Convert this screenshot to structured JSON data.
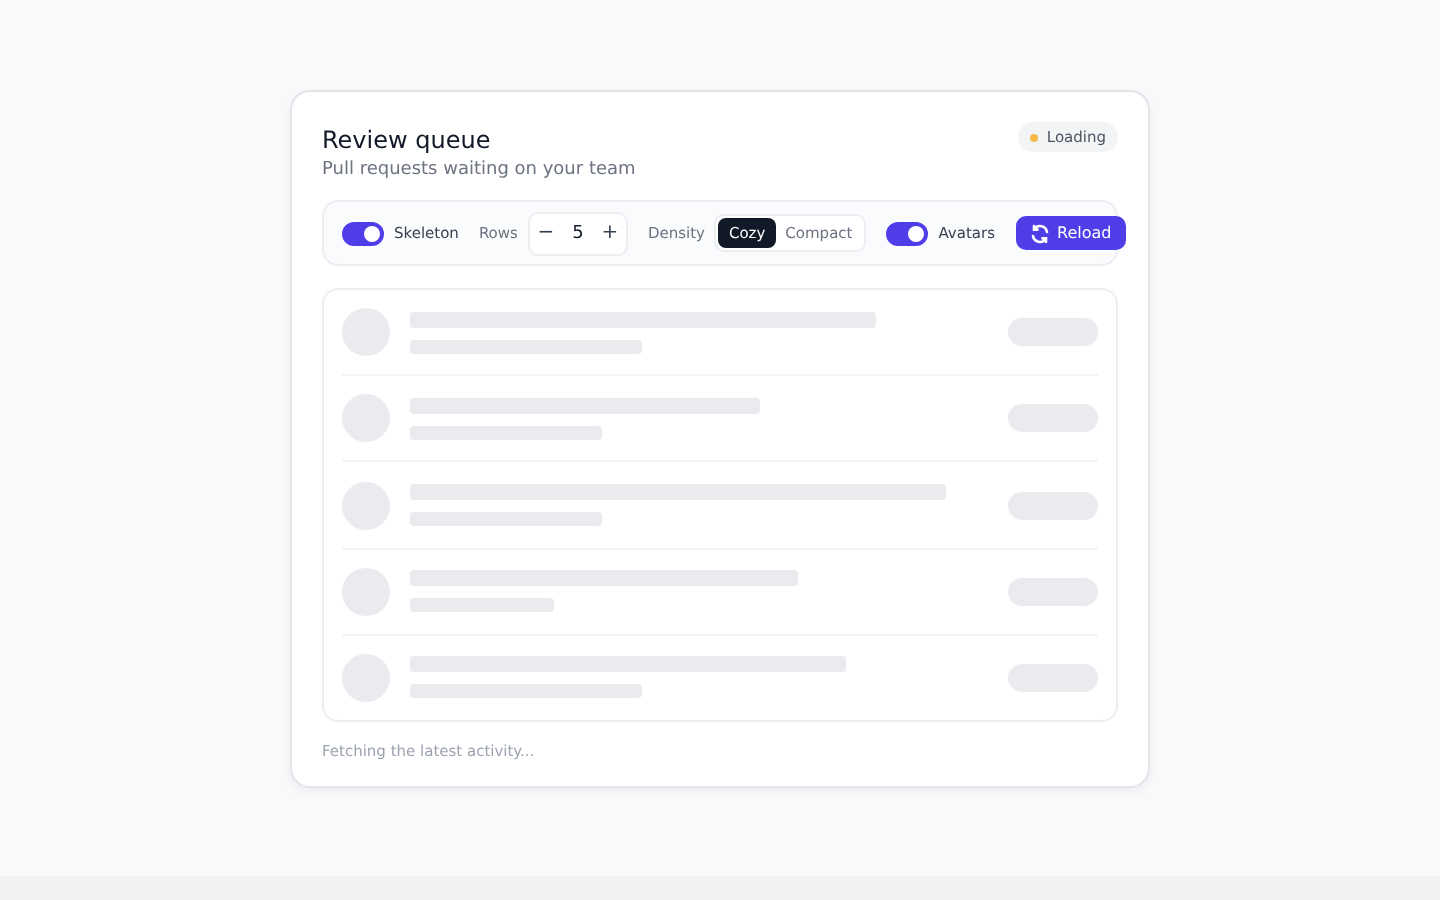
{
  "card": {
    "title": "Review queue",
    "subtitle": "Pull requests waiting on your team",
    "status": {
      "label": "Loading",
      "color": "#f5b94a"
    }
  },
  "toolbar": {
    "skeleton": {
      "label": "Skeleton",
      "on": true
    },
    "rows": {
      "label": "Rows",
      "decrement": "−",
      "value": "5",
      "increment": "+"
    },
    "density": {
      "label": "Density",
      "options": [
        {
          "label": "Cozy",
          "selected": true
        },
        {
          "label": "Compact",
          "selected": false
        }
      ]
    },
    "avatars": {
      "label": "Avatars",
      "on": true
    },
    "reload": {
      "label": "Reload"
    }
  },
  "footer": "Fetching the latest activity..."
}
